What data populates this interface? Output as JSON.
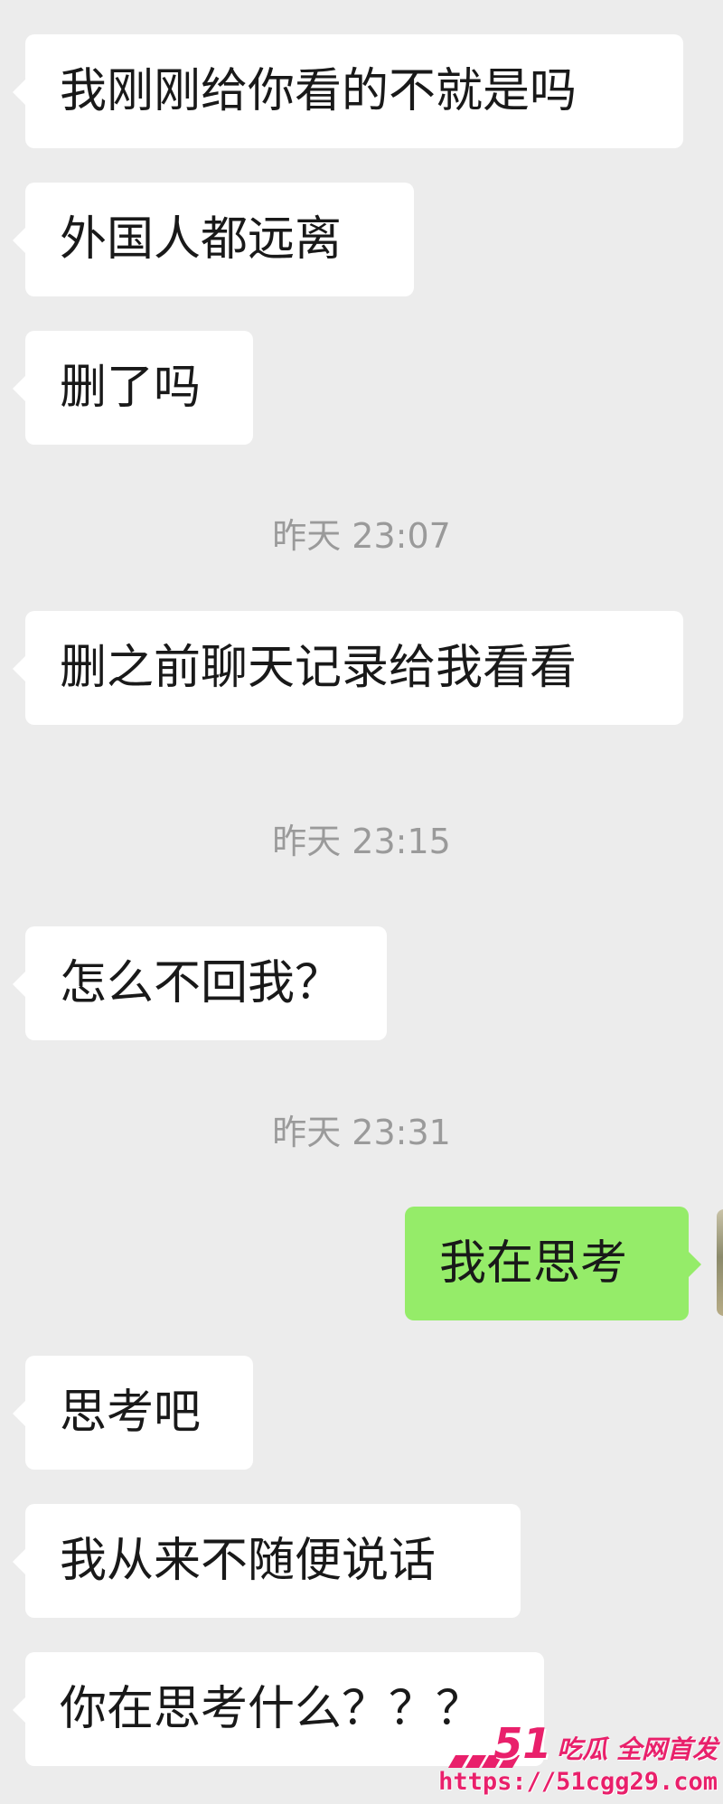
{
  "messages": [
    {
      "text": "我刚刚给你看的不就是吗"
    },
    {
      "text": "外国人都远离"
    },
    {
      "text": "删了吗"
    },
    {
      "text": "删之前聊天记录给我看看"
    },
    {
      "text": "怎么不回我？"
    },
    {
      "text": "我在思考"
    },
    {
      "text": "思考吧"
    },
    {
      "text": "我从来不随便说话"
    },
    {
      "text": "你在思考什么？？？"
    }
  ],
  "timestamps": [
    {
      "text": "昨天 23:07"
    },
    {
      "text": "昨天 23:15"
    },
    {
      "text": "昨天 23:31"
    }
  ],
  "watermark": {
    "brand_number": "51",
    "brand_text": "吃瓜 全网首发",
    "url": "https://51cgg29.com"
  },
  "colors": {
    "background": "#ececec",
    "incoming_bubble": "#ffffff",
    "outgoing_bubble": "#95ec69",
    "timestamp_text": "#9a9a9a",
    "watermark": "#e9206b"
  }
}
